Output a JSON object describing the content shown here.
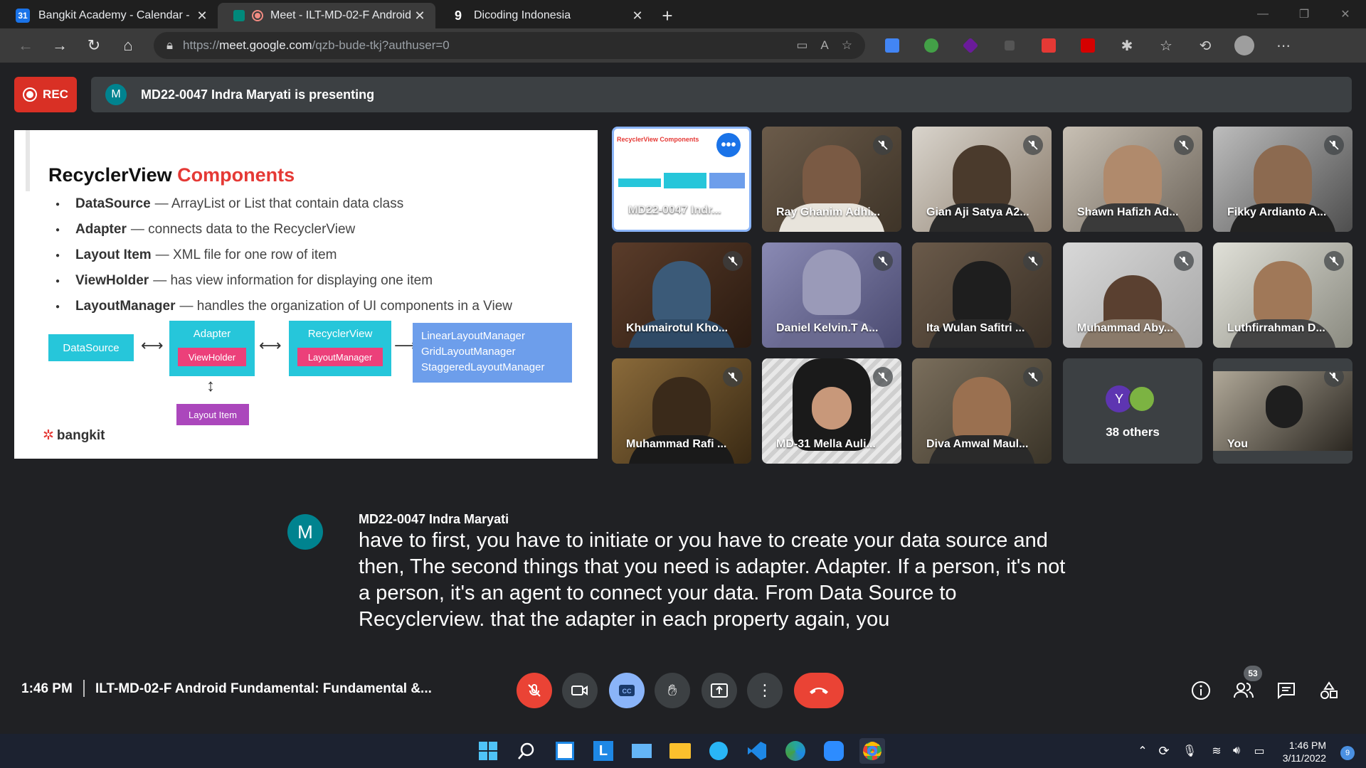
{
  "browser": {
    "tabs": [
      {
        "title": "Bangkit Academy - Calendar - Fr",
        "favicon": "calendar-icon"
      },
      {
        "title": "Meet - ILT-MD-02-F Android",
        "favicon": "meet-icon",
        "active": true
      },
      {
        "title": "Dicoding Indonesia",
        "favicon": "dicoding-icon"
      }
    ],
    "url": {
      "protocol": "https://",
      "host": "meet.google.com",
      "path": "/qzb-bude-tkj?authuser=0"
    }
  },
  "meet": {
    "rec_label": "REC",
    "presenting": {
      "initial": "M",
      "text": "MD22-0047 Indra Maryati is presenting"
    },
    "slide": {
      "title_a": "RecyclerView",
      "title_b": "Components",
      "bullets": [
        {
          "term": "DataSource",
          "desc": "— ArrayList or List that contain data class"
        },
        {
          "term": "Adapter",
          "desc": "— connects data to the RecyclerView"
        },
        {
          "term": "Layout Item",
          "desc": "— XML file for one row of  item"
        },
        {
          "term": "ViewHolder",
          "desc": "— has view information for displaying one item"
        },
        {
          "term": "LayoutManager",
          "desc": "— handles the organization of UI components in a View"
        }
      ],
      "diagram": {
        "datasource": "DataSource",
        "adapter": "Adapter",
        "viewholder": "ViewHolder",
        "recyclerview": "RecyclerView",
        "layoutmanager": "LayoutManager",
        "layout_item": "Layout Item",
        "managers": [
          "LinearLayoutManager",
          "GridLayoutManager",
          "StaggeredLayoutManager"
        ]
      },
      "logo": "bangkit"
    },
    "participants": [
      {
        "name": "MD22-0047 Indr...",
        "presenter": true
      },
      {
        "name": "Ray Ghanim Adhi..."
      },
      {
        "name": "Gian Aji Satya A2..."
      },
      {
        "name": "Shawn Hafizh Ad..."
      },
      {
        "name": "Fikky Ardianto A..."
      },
      {
        "name": "Khumairotul Kho..."
      },
      {
        "name": "Daniel Kelvin.T A..."
      },
      {
        "name": "Ita Wulan Safitri ..."
      },
      {
        "name": "Muhammad Aby..."
      },
      {
        "name": "Luthfirrahman D..."
      },
      {
        "name": "Muhammad Rafi ..."
      },
      {
        "name": "MD-31 Mella Auli..."
      },
      {
        "name": "Diva Amwal Maul..."
      },
      {
        "name": "You"
      }
    ],
    "others": {
      "initial": "Y",
      "label": "38 others"
    },
    "caption": {
      "initial": "M",
      "speaker": "MD22-0047 Indra Maryati",
      "text": "have to first, you have to initiate or you have to create your data source and then, The second things that you need is adapter. Adapter. If a person, it's not a person, it's an agent to connect your data. From Data Source to Recyclerview. that the adapter in each property again, you"
    },
    "bottom_bar": {
      "time": "1:46 PM",
      "meeting_title": "ILT-MD-02-F Android Fundamental: Fundamental &...",
      "people_count": "53"
    }
  },
  "taskbar": {
    "time": "1:46 PM",
    "date": "3/11/2022",
    "notifications": "9"
  },
  "colors": {
    "meet_bg": "#202124",
    "tile_bg": "#3c4043",
    "rec_red": "#d93025",
    "cc_blue": "#8ab4f8",
    "slide_red": "#e53935",
    "diagram_teal": "#26c6da",
    "diagram_pink": "#ec407a"
  }
}
